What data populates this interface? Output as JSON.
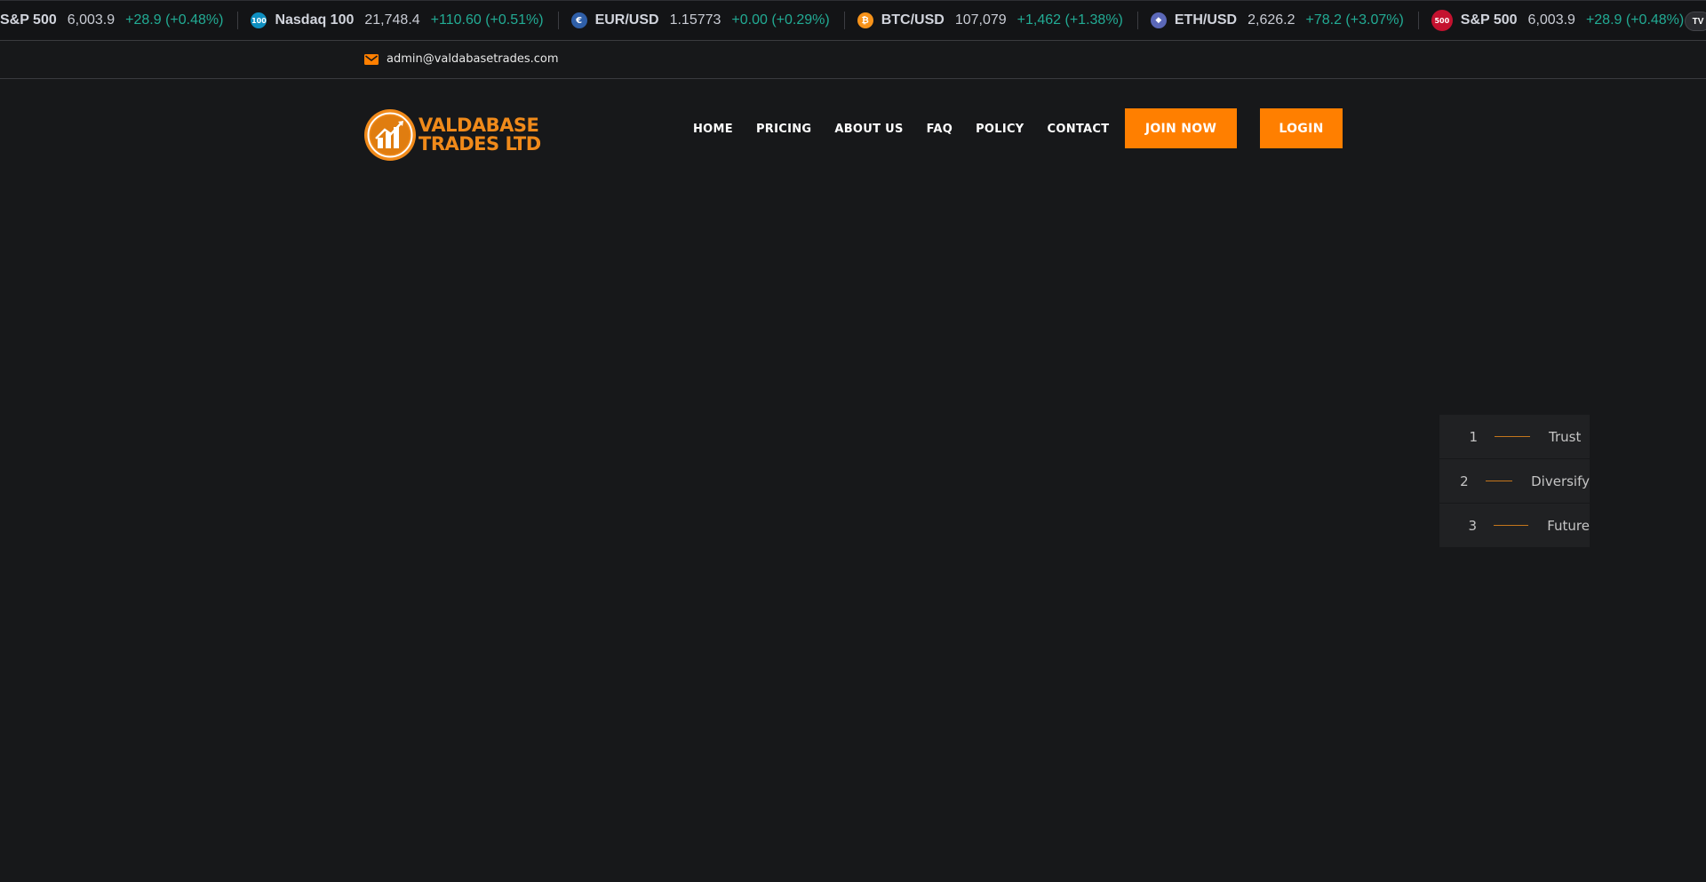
{
  "ticker": {
    "items": [
      {
        "symbol": "S&P 500",
        "price": "6,003.9",
        "change": "+28.9 (+0.48%)",
        "icon": "sp500-icon",
        "icon_text": "500",
        "icon_color": "#c4122f"
      },
      {
        "symbol": "Nasdaq 100",
        "price": "21,748.4",
        "change": "+110.60 (+0.51%)",
        "icon": "nasdaq-icon",
        "icon_text": "100",
        "icon_color": "#0e8fc0"
      },
      {
        "symbol": "EUR/USD",
        "price": "1.15773",
        "change": "+0.00 (+0.29%)",
        "icon": "euro-flag-icon",
        "icon_text": "€",
        "icon_color": "#2f5fa8"
      },
      {
        "symbol": "BTC/USD",
        "price": "107,079",
        "change": "+1,462 (+1.38%)",
        "icon": "bitcoin-icon",
        "icon_text": "₿",
        "icon_color": "#f7931a"
      },
      {
        "symbol": "ETH/USD",
        "price": "2,626.2",
        "change": "+78.2 (+3.07%)",
        "icon": "ethereum-icon",
        "icon_text": "◆",
        "icon_color": "#5b68b8"
      },
      {
        "symbol": "S&P 500",
        "price": "6,003.9",
        "change": "+28.9 (+0.48%)",
        "icon": "sp500-icon",
        "icon_text": "500",
        "icon_color": "#c4122f"
      }
    ],
    "badge": "TV"
  },
  "infobar": {
    "email": "admin@valdabasetrades.com"
  },
  "brand": {
    "line1": "VALDABASE",
    "line2": "TRADES LTD",
    "color": "#f08a1a"
  },
  "nav": {
    "items": [
      "HOME",
      "PRICING",
      "ABOUT US",
      "FAQ",
      "POLICY",
      "CONTACT"
    ],
    "join_label": "JOIN NOW",
    "login_label": "LOGIN"
  },
  "slider": {
    "pager": [
      {
        "num": "1",
        "label": "Trust"
      },
      {
        "num": "2",
        "label": "Diversify"
      },
      {
        "num": "3",
        "label": "Future"
      }
    ]
  },
  "colors": {
    "accent": "#ff7f00",
    "positive": "#22ab94",
    "background": "#17181a"
  }
}
